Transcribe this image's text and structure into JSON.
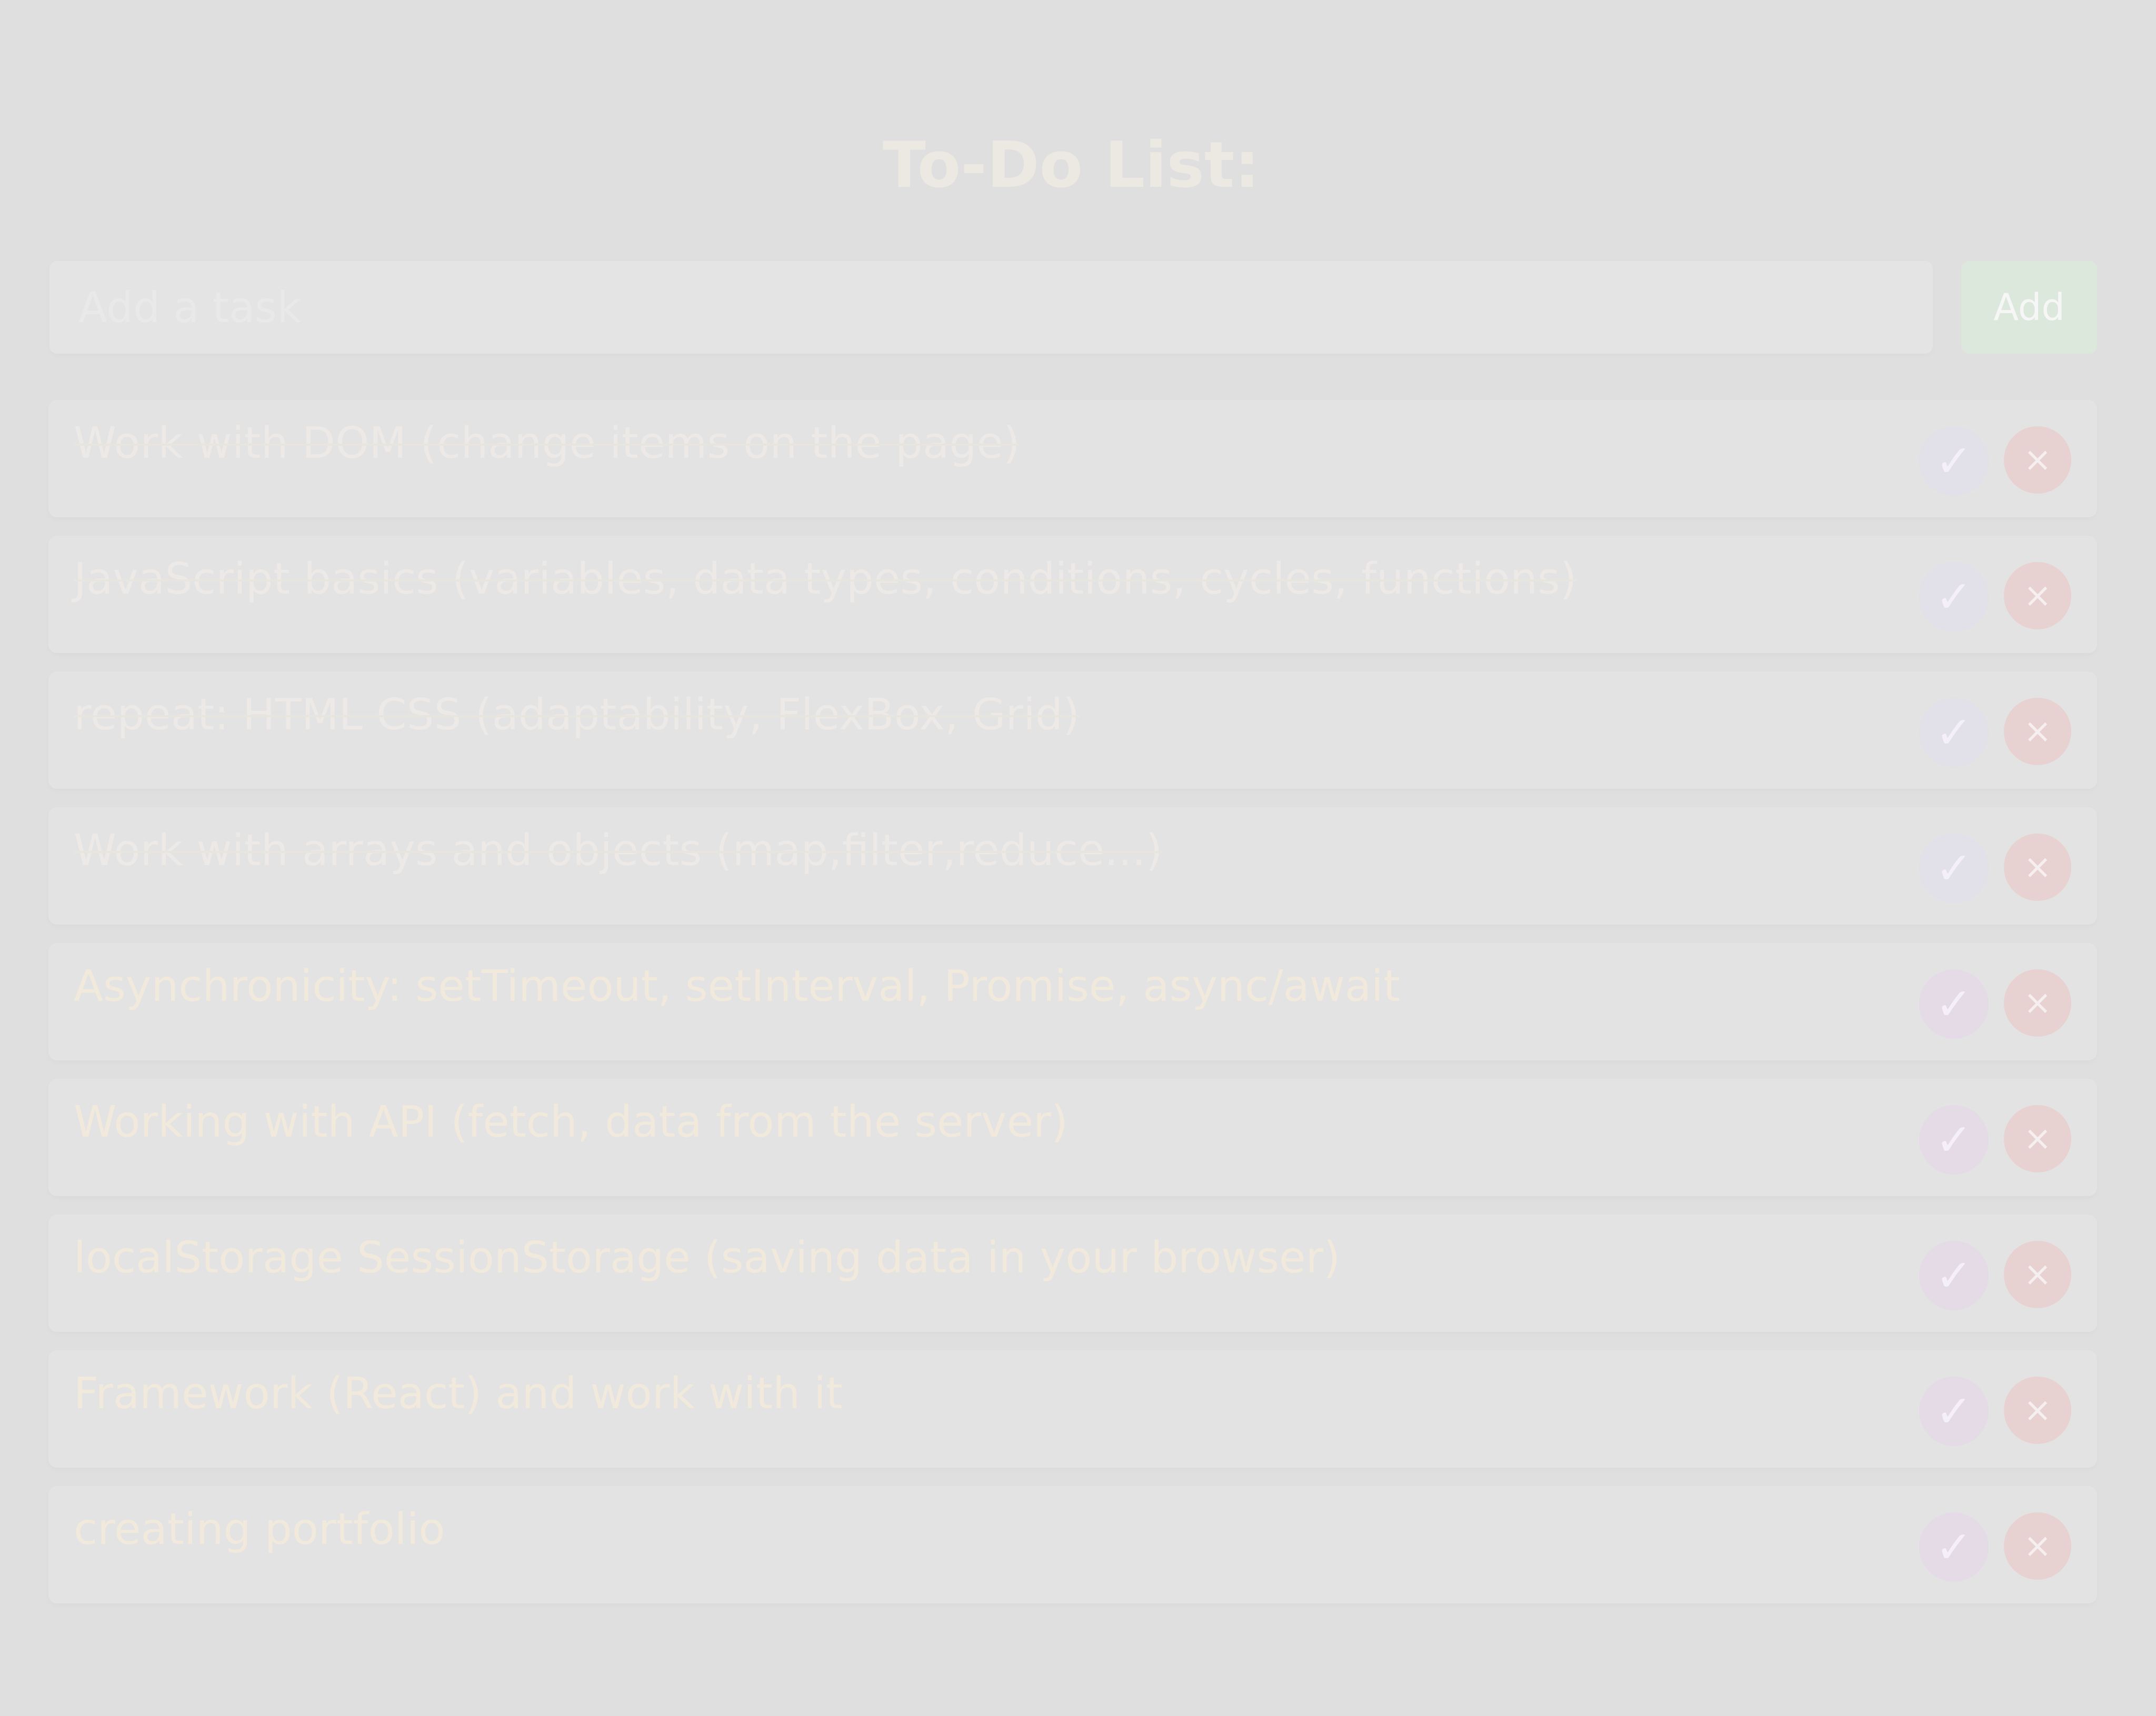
{
  "app": {
    "title": "To-Do List:"
  },
  "input": {
    "value": "",
    "placeholder": "Add a task"
  },
  "actions": {
    "add_label": "Add",
    "complete_icon": "✓",
    "delete_icon": "×"
  },
  "tasks": [
    {
      "text": "Work with DOM (change items on the page)",
      "done": true
    },
    {
      "text": "JavaScript basics (variables, data types, conditions, cycles, functions)",
      "done": true
    },
    {
      "text": "repeat: HTML CSS (adaptability, FlexBox, Grid)",
      "done": true
    },
    {
      "text": "Work with arrays and objects (map,filter,reduce...)",
      "done": true
    },
    {
      "text": "Asynchronicity: setTimeout, setInterval, Promise, async/await",
      "done": false
    },
    {
      "text": "Working with API (fetch, data from the server)",
      "done": false
    },
    {
      "text": "localStorage SessionStorage (saving data in your browser)",
      "done": false
    },
    {
      "text": "Framework (React) and work with it",
      "done": false
    },
    {
      "text": "creating portfolio",
      "done": false
    }
  ]
}
